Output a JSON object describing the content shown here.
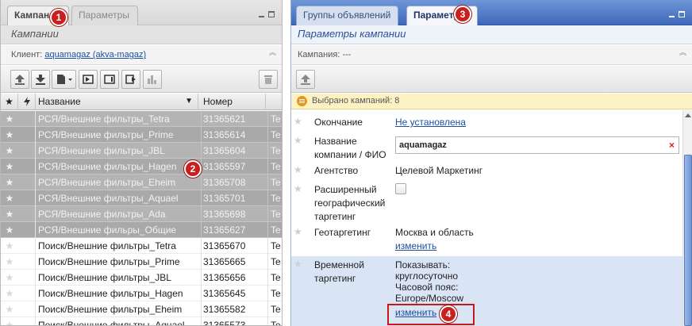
{
  "left_panel": {
    "tabs": [
      {
        "label": "Кампании",
        "active": true
      },
      {
        "label": "Параметры",
        "active": false
      }
    ],
    "subtitle": "Кампании",
    "client_label": "Клиент:",
    "client_link": "aquamagaz (akva-magaz)",
    "toolbar_icons": [
      "upload-icon",
      "download-icon",
      "document-dropdown-icon",
      "flag-icon",
      "stop-icon",
      "play-icon",
      "stats-chart-icon",
      "trash-icon"
    ],
    "columns": {
      "name": "Название",
      "number": "Номер"
    },
    "rows": [
      {
        "name": "РСЯ/Внешние фильтры_Tetra",
        "number": "31365621",
        "type": "Te",
        "selected": true
      },
      {
        "name": "РСЯ/Внешние фильтры_Prime",
        "number": "31365614",
        "type": "Te",
        "selected": true
      },
      {
        "name": "РСЯ/Внешние фильтры_JBL",
        "number": "31365604",
        "type": "Te",
        "selected": true
      },
      {
        "name": "РСЯ/Внешние фильтры_Hagen",
        "number": "31365597",
        "type": "Te",
        "selected": true
      },
      {
        "name": "РСЯ/Внешние фильтры_Eheim",
        "number": "31365708",
        "type": "Te",
        "selected": true
      },
      {
        "name": "РСЯ/Внешние фильтры_Aquael",
        "number": "31365701",
        "type": "Te",
        "selected": true
      },
      {
        "name": "РСЯ/Внешние фильтры_Ada",
        "number": "31365698",
        "type": "Te",
        "selected": true
      },
      {
        "name": "РСЯ/Внешние фильры_Общие",
        "number": "31365627",
        "type": "Te",
        "selected": true
      },
      {
        "name": "Поиск/Внешние фильтры_Tetra",
        "number": "31365670",
        "type": "Te",
        "selected": false
      },
      {
        "name": "Поиск/Внешние фильтры_Prime",
        "number": "31365665",
        "type": "Te",
        "selected": false
      },
      {
        "name": "Поиск/Внешние фильтры_JBL",
        "number": "31365656",
        "type": "Te",
        "selected": false
      },
      {
        "name": "Поиск/Внешние фильтры_Hagen",
        "number": "31365645",
        "type": "Te",
        "selected": false
      },
      {
        "name": "Поиск/Внешние фильтры_Eheim",
        "number": "31365582",
        "type": "Te",
        "selected": false
      },
      {
        "name": "Поиск/Внешние фильтры_Aquael",
        "number": "31365573",
        "type": "Te",
        "selected": false
      }
    ]
  },
  "right_panel": {
    "tabs": [
      {
        "label": "Группы объявлений",
        "active": false
      },
      {
        "label": "Параметры",
        "active": true
      }
    ],
    "subtitle": "Параметры кампании",
    "campaign_label": "Кампания: ---",
    "info_text": "Выбрано кампаний: 8",
    "fields": {
      "end_label": "Окончание",
      "end_value": "Не установлена",
      "name_label": "Название компании / ФИО",
      "name_value": "aquamagaz",
      "agency_label": "Агентство",
      "agency_value": "Целевой Маркетинг",
      "geo_ext_label": "Расширенный географический таргетинг",
      "geo_label": "Геотаргетинг",
      "geo_value": "Москва и область",
      "geo_change": "изменить",
      "time_label": "Временной таргетинг",
      "time_value_1": "Показывать:",
      "time_value_2": "круглосуточно",
      "time_value_3": "Часовой пояс:",
      "time_value_4": "Europe/Moscow",
      "time_change": "изменить"
    }
  },
  "badges": [
    "1",
    "2",
    "3",
    "4"
  ],
  "colors": {
    "selected_row": "#b4b4b4",
    "accent_blue": "#3e68b8",
    "badge_red": "#c9201d",
    "info_bar": "#fdf2c4",
    "highlight_row": "#d9e4f5"
  }
}
